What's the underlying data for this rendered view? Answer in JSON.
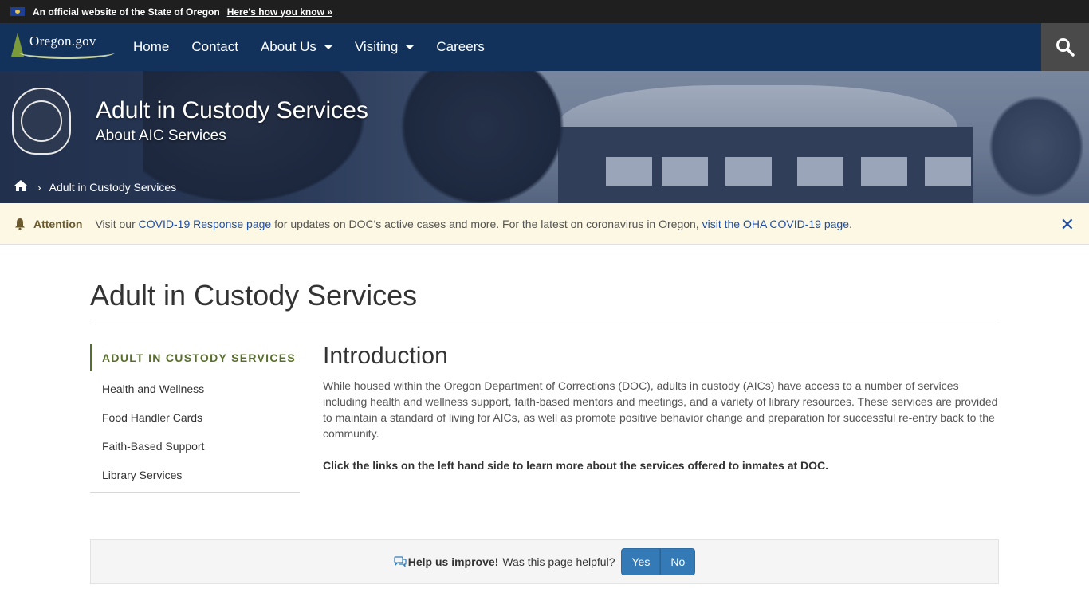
{
  "official_bar": {
    "text": "An official website of the State of Oregon",
    "link": "Here's how you know »"
  },
  "nav": {
    "logo": "Oregon.gov",
    "items": [
      {
        "label": "Home"
      },
      {
        "label": "Contact"
      },
      {
        "label": "About Us"
      },
      {
        "label": "Visiting"
      },
      {
        "label": "Careers"
      }
    ],
    "search_icon": "search-icon"
  },
  "hero": {
    "title": "Adult in Custody Services",
    "subtitle": "About AIC Services",
    "breadcrumb": {
      "home_icon": "home-icon",
      "current": "Adult in Custody Services"
    }
  },
  "alert": {
    "label": "Attention",
    "text_1": "Visit our ",
    "link_1": "COVID-19 Response page",
    "text_2": " for updates on DOC's active cases and more. For the latest on coronavirus in Oregon, ",
    "link_2": "visit the OHA COVID-19 page",
    "text_3": "."
  },
  "main": {
    "title": "Adult in Custody Services",
    "sidebar": {
      "heading": "ADULT IN CUSTODY SERVICES",
      "items": [
        {
          "label": "Health and Wellness"
        },
        {
          "label": "Food Handler Cards"
        },
        {
          "label": "Faith-Based Support"
        },
        {
          "label": "Library Services"
        }
      ]
    },
    "content": {
      "heading": "Introduction",
      "paragraph": "While housed within the Oregon Department of Corrections (DOC), adults in custody (AICs) have access to a number of services including health and wellness support, faith-based mentors and meetings, and a variety of library resources. These services are provided to maintain a standard of living for AICs, as well as promote positive behavior change and preparation for successful re-entry back to the community.",
      "bold_paragraph": "Click the links on the left hand side to learn more about the services offered to inmates at DOC."
    }
  },
  "feedback": {
    "strong": "Help us improve!",
    "question": "Was this page helpful?",
    "yes": "Yes",
    "no": "No"
  },
  "colors": {
    "nav_bg": "#12325c",
    "accent_green": "#586f2c",
    "alert_bg": "#fcf8e3",
    "button_blue": "#337ab7"
  }
}
